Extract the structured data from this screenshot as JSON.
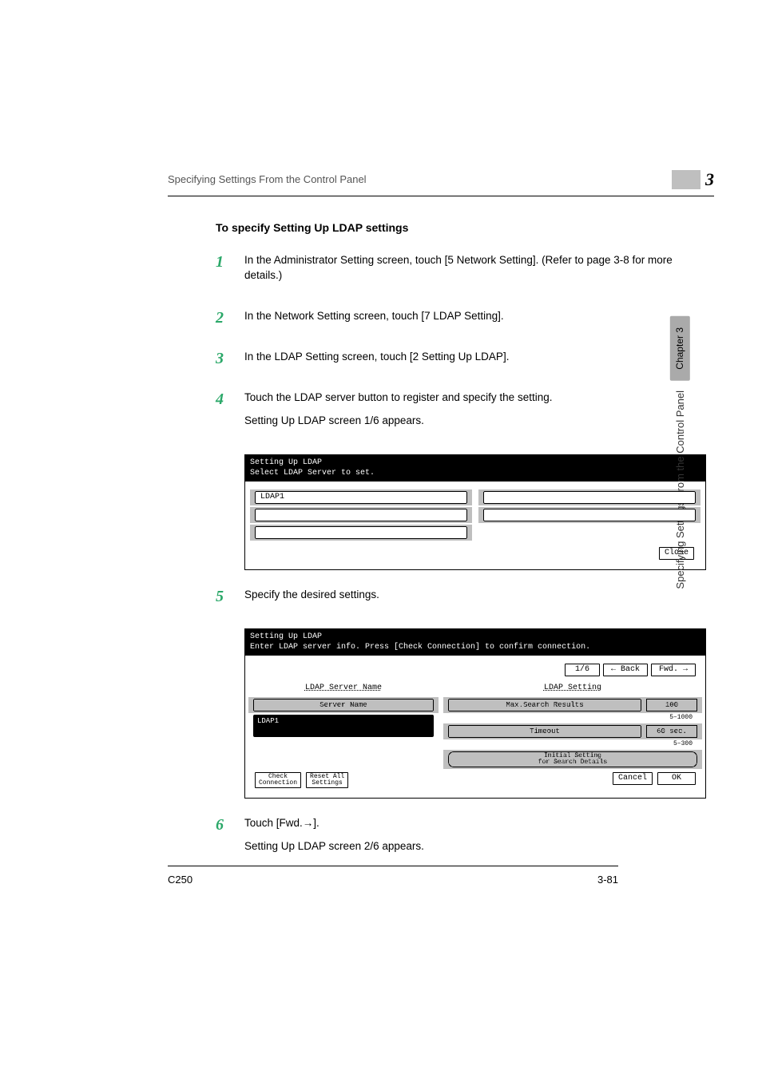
{
  "header": {
    "running_head": "Specifying Settings From the Control Panel",
    "chapter_number": "3"
  },
  "subtitle": "To specify Setting Up LDAP settings",
  "steps": [
    {
      "num": "1",
      "text1": "In the Administrator Setting screen, touch [5 Network Setting]. (Refer to page 3-8 for more details.)"
    },
    {
      "num": "2",
      "text1": "In the Network Setting screen, touch [7 LDAP Setting]."
    },
    {
      "num": "3",
      "text1": "In the LDAP Setting screen, touch [2 Setting Up LDAP]."
    },
    {
      "num": "4",
      "text1": "Touch the LDAP server button to register and specify the setting.",
      "text2": "Setting Up LDAP screen 1/6 appears."
    },
    {
      "num": "5",
      "text1": "Specify the desired settings."
    },
    {
      "num": "6",
      "text1": "Touch [Fwd.→].",
      "text2": "Setting Up LDAP screen 2/6 appears."
    }
  ],
  "screen1": {
    "title": "Setting Up LDAP",
    "subtitle": "Select LDAP Server to set.",
    "ldap_buttons": [
      "LDAP1",
      "",
      "",
      "",
      ""
    ],
    "close": "Close"
  },
  "screen2": {
    "title": "Setting Up LDAP",
    "subtitle": "Enter LDAP server info. Press [Check Connection] to confirm connection.",
    "pager": "1/6",
    "back": "Back",
    "fwd": "Fwd.",
    "left_header": "LDAP Server Name",
    "server_name_label": "Server Name",
    "server_name_value": "LDAP1",
    "right_header": "LDAP Setting",
    "max_results_label": "Max.Search Results",
    "max_results_value": "100",
    "max_results_range": "5–1000",
    "timeout_label": "Timeout",
    "timeout_value": "60 sec.",
    "timeout_range": "5–300",
    "initial_label": "Initial Setting\nfor Search Details",
    "check_conn": "Check\nConnection",
    "reset_all": "Reset All\nSettings",
    "cancel": "Cancel",
    "ok": "OK"
  },
  "sidebar": {
    "chip": "Chapter 3",
    "label": "Specifying Settings From the Control Panel"
  },
  "footer": {
    "model": "C250",
    "page": "3-81"
  }
}
